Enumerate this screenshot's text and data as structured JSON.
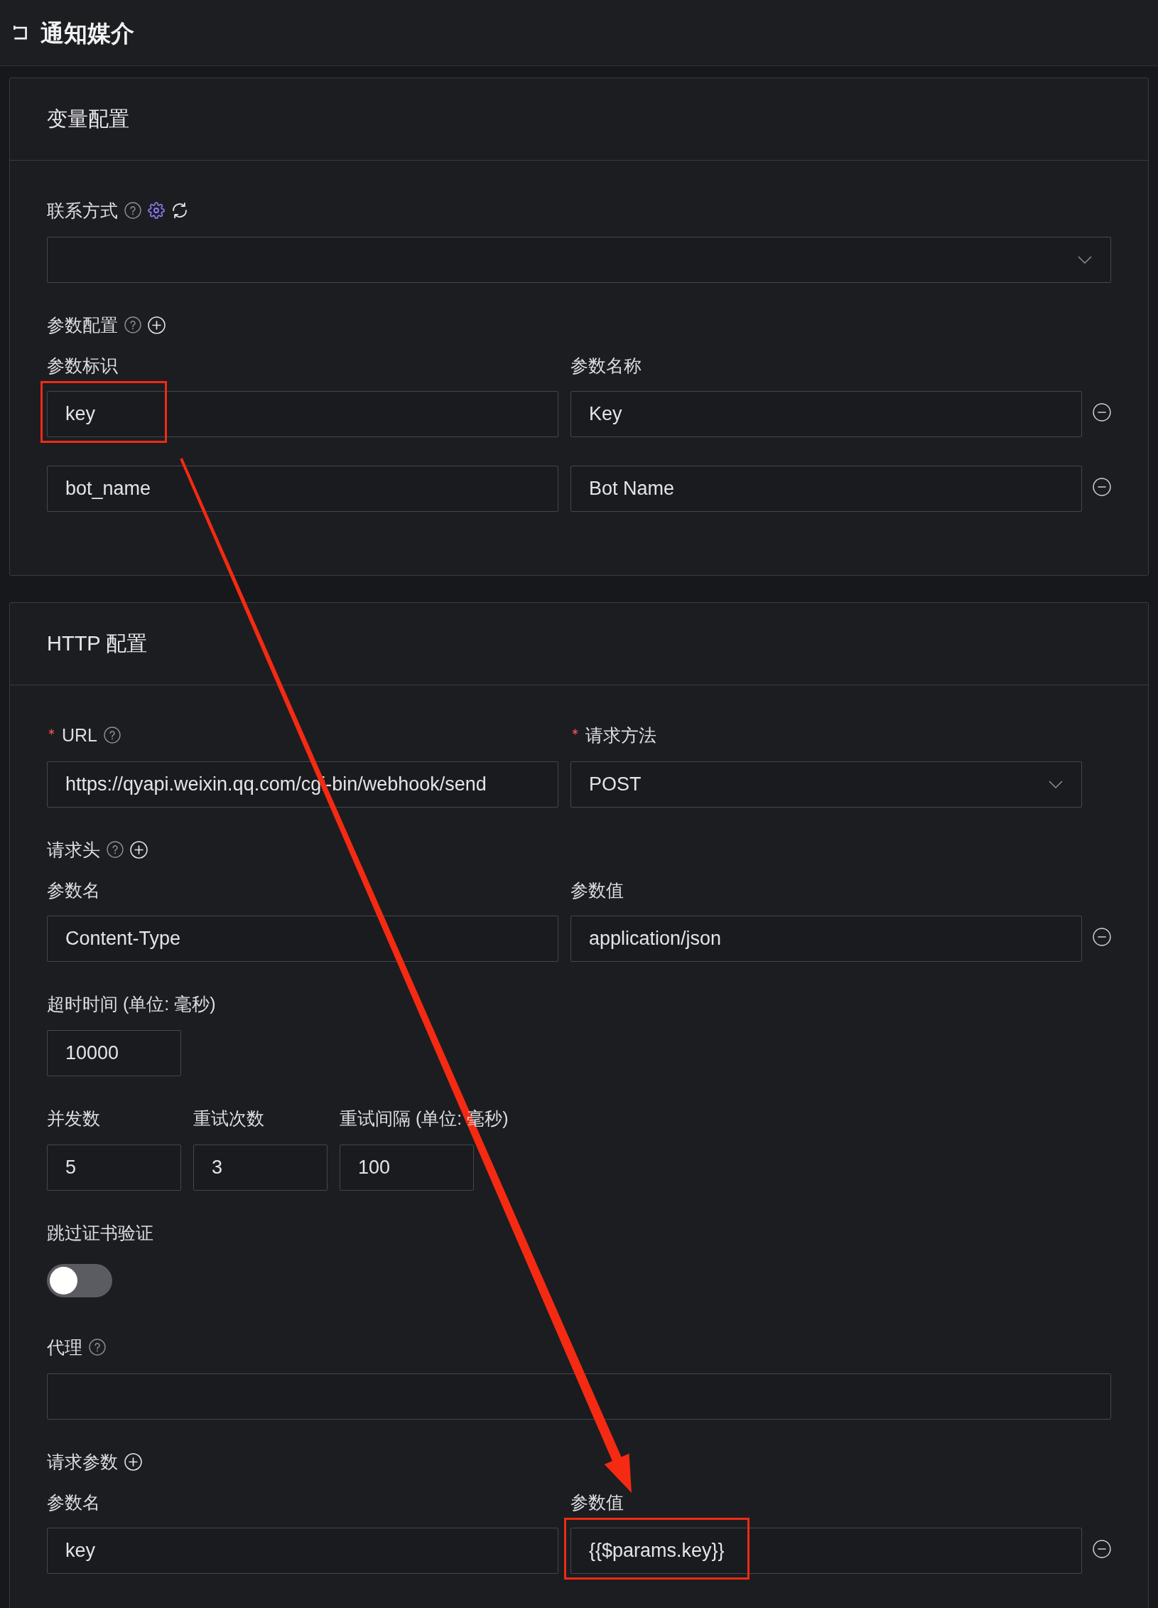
{
  "header": {
    "title": "通知媒介"
  },
  "sections": [
    {
      "title": "变量配置",
      "items": [
        {
          "kind": "select",
          "label": "联系方式",
          "help": true,
          "settings": true,
          "refresh": true
        },
        {
          "kind": "pairs",
          "label": "参数配置",
          "help": true,
          "add": true,
          "columns": [
            "参数标识",
            "参数名称"
          ],
          "rows": [
            [
              {
                "value": "key",
                "highlighted": true
              },
              {
                "value": "Key"
              }
            ],
            [
              {
                "value": "bot_name"
              },
              {
                "value": "Bot Name"
              }
            ]
          ]
        }
      ]
    },
    {
      "title": "HTTP 配置",
      "items": [
        {
          "kind": "columns",
          "fields": [
            {
              "kind": "text",
              "label": "URL",
              "required": true,
              "help": true,
              "value": "https://qyapi.weixin.qq.com/cgi-bin/webhook/send"
            },
            {
              "kind": "select",
              "label": "请求方法",
              "required": true,
              "value": "POST"
            }
          ]
        },
        {
          "kind": "pairs",
          "label": "请求头",
          "help": true,
          "add": true,
          "columns": [
            "参数名",
            "参数值"
          ],
          "rows": [
            [
              {
                "value": "Content-Type"
              },
              {
                "value": "application/json"
              }
            ]
          ]
        },
        {
          "kind": "number",
          "label": "超时时间 (单位: 毫秒)",
          "value": "10000"
        },
        {
          "kind": "columns",
          "fields": [
            {
              "kind": "number",
              "label": "并发数",
              "value": "5"
            },
            {
              "kind": "number",
              "label": "重试次数",
              "value": "3"
            },
            {
              "kind": "number",
              "label": "重试间隔 (单位: 毫秒)",
              "value": "100"
            }
          ]
        },
        {
          "kind": "switch",
          "label": "跳过证书验证",
          "on": false
        },
        {
          "kind": "text",
          "label": "代理",
          "help": true
        },
        {
          "kind": "pairs",
          "label": "请求参数",
          "add": true,
          "columns": [
            "参数名",
            "参数值"
          ],
          "rows": [
            [
              {
                "value": "key"
              },
              {
                "value": "{{$params.key}}",
                "highlighted": true
              }
            ]
          ]
        }
      ]
    }
  ],
  "annotation_arrow": true
}
